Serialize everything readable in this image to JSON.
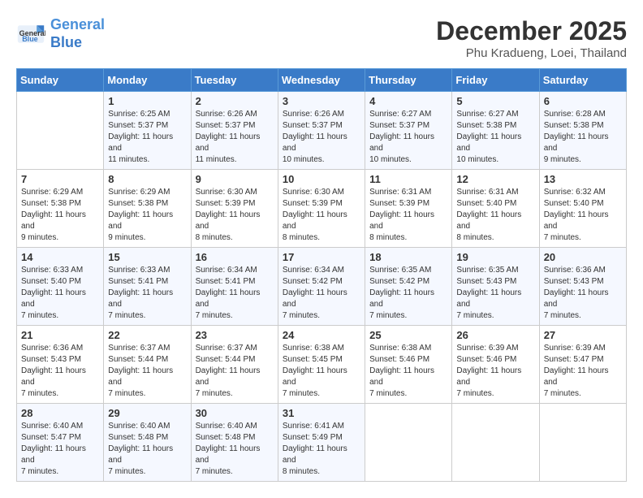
{
  "header": {
    "logo_line1": "General",
    "logo_line2": "Blue",
    "month": "December 2025",
    "location": "Phu Kradueng, Loei, Thailand"
  },
  "weekdays": [
    "Sunday",
    "Monday",
    "Tuesday",
    "Wednesday",
    "Thursday",
    "Friday",
    "Saturday"
  ],
  "weeks": [
    [
      {
        "day": "",
        "sunrise": "",
        "sunset": "",
        "daylight": ""
      },
      {
        "day": "1",
        "sunrise": "Sunrise: 6:25 AM",
        "sunset": "Sunset: 5:37 PM",
        "daylight": "Daylight: 11 hours and 11 minutes."
      },
      {
        "day": "2",
        "sunrise": "Sunrise: 6:26 AM",
        "sunset": "Sunset: 5:37 PM",
        "daylight": "Daylight: 11 hours and 11 minutes."
      },
      {
        "day": "3",
        "sunrise": "Sunrise: 6:26 AM",
        "sunset": "Sunset: 5:37 PM",
        "daylight": "Daylight: 11 hours and 10 minutes."
      },
      {
        "day": "4",
        "sunrise": "Sunrise: 6:27 AM",
        "sunset": "Sunset: 5:37 PM",
        "daylight": "Daylight: 11 hours and 10 minutes."
      },
      {
        "day": "5",
        "sunrise": "Sunrise: 6:27 AM",
        "sunset": "Sunset: 5:38 PM",
        "daylight": "Daylight: 11 hours and 10 minutes."
      },
      {
        "day": "6",
        "sunrise": "Sunrise: 6:28 AM",
        "sunset": "Sunset: 5:38 PM",
        "daylight": "Daylight: 11 hours and 9 minutes."
      }
    ],
    [
      {
        "day": "7",
        "sunrise": "Sunrise: 6:29 AM",
        "sunset": "Sunset: 5:38 PM",
        "daylight": "Daylight: 11 hours and 9 minutes."
      },
      {
        "day": "8",
        "sunrise": "Sunrise: 6:29 AM",
        "sunset": "Sunset: 5:38 PM",
        "daylight": "Daylight: 11 hours and 9 minutes."
      },
      {
        "day": "9",
        "sunrise": "Sunrise: 6:30 AM",
        "sunset": "Sunset: 5:39 PM",
        "daylight": "Daylight: 11 hours and 8 minutes."
      },
      {
        "day": "10",
        "sunrise": "Sunrise: 6:30 AM",
        "sunset": "Sunset: 5:39 PM",
        "daylight": "Daylight: 11 hours and 8 minutes."
      },
      {
        "day": "11",
        "sunrise": "Sunrise: 6:31 AM",
        "sunset": "Sunset: 5:39 PM",
        "daylight": "Daylight: 11 hours and 8 minutes."
      },
      {
        "day": "12",
        "sunrise": "Sunrise: 6:31 AM",
        "sunset": "Sunset: 5:40 PM",
        "daylight": "Daylight: 11 hours and 8 minutes."
      },
      {
        "day": "13",
        "sunrise": "Sunrise: 6:32 AM",
        "sunset": "Sunset: 5:40 PM",
        "daylight": "Daylight: 11 hours and 7 minutes."
      }
    ],
    [
      {
        "day": "14",
        "sunrise": "Sunrise: 6:33 AM",
        "sunset": "Sunset: 5:40 PM",
        "daylight": "Daylight: 11 hours and 7 minutes."
      },
      {
        "day": "15",
        "sunrise": "Sunrise: 6:33 AM",
        "sunset": "Sunset: 5:41 PM",
        "daylight": "Daylight: 11 hours and 7 minutes."
      },
      {
        "day": "16",
        "sunrise": "Sunrise: 6:34 AM",
        "sunset": "Sunset: 5:41 PM",
        "daylight": "Daylight: 11 hours and 7 minutes."
      },
      {
        "day": "17",
        "sunrise": "Sunrise: 6:34 AM",
        "sunset": "Sunset: 5:42 PM",
        "daylight": "Daylight: 11 hours and 7 minutes."
      },
      {
        "day": "18",
        "sunrise": "Sunrise: 6:35 AM",
        "sunset": "Sunset: 5:42 PM",
        "daylight": "Daylight: 11 hours and 7 minutes."
      },
      {
        "day": "19",
        "sunrise": "Sunrise: 6:35 AM",
        "sunset": "Sunset: 5:43 PM",
        "daylight": "Daylight: 11 hours and 7 minutes."
      },
      {
        "day": "20",
        "sunrise": "Sunrise: 6:36 AM",
        "sunset": "Sunset: 5:43 PM",
        "daylight": "Daylight: 11 hours and 7 minutes."
      }
    ],
    [
      {
        "day": "21",
        "sunrise": "Sunrise: 6:36 AM",
        "sunset": "Sunset: 5:43 PM",
        "daylight": "Daylight: 11 hours and 7 minutes."
      },
      {
        "day": "22",
        "sunrise": "Sunrise: 6:37 AM",
        "sunset": "Sunset: 5:44 PM",
        "daylight": "Daylight: 11 hours and 7 minutes."
      },
      {
        "day": "23",
        "sunrise": "Sunrise: 6:37 AM",
        "sunset": "Sunset: 5:44 PM",
        "daylight": "Daylight: 11 hours and 7 minutes."
      },
      {
        "day": "24",
        "sunrise": "Sunrise: 6:38 AM",
        "sunset": "Sunset: 5:45 PM",
        "daylight": "Daylight: 11 hours and 7 minutes."
      },
      {
        "day": "25",
        "sunrise": "Sunrise: 6:38 AM",
        "sunset": "Sunset: 5:46 PM",
        "daylight": "Daylight: 11 hours and 7 minutes."
      },
      {
        "day": "26",
        "sunrise": "Sunrise: 6:39 AM",
        "sunset": "Sunset: 5:46 PM",
        "daylight": "Daylight: 11 hours and 7 minutes."
      },
      {
        "day": "27",
        "sunrise": "Sunrise: 6:39 AM",
        "sunset": "Sunset: 5:47 PM",
        "daylight": "Daylight: 11 hours and 7 minutes."
      }
    ],
    [
      {
        "day": "28",
        "sunrise": "Sunrise: 6:40 AM",
        "sunset": "Sunset: 5:47 PM",
        "daylight": "Daylight: 11 hours and 7 minutes."
      },
      {
        "day": "29",
        "sunrise": "Sunrise: 6:40 AM",
        "sunset": "Sunset: 5:48 PM",
        "daylight": "Daylight: 11 hours and 7 minutes."
      },
      {
        "day": "30",
        "sunrise": "Sunrise: 6:40 AM",
        "sunset": "Sunset: 5:48 PM",
        "daylight": "Daylight: 11 hours and 7 minutes."
      },
      {
        "day": "31",
        "sunrise": "Sunrise: 6:41 AM",
        "sunset": "Sunset: 5:49 PM",
        "daylight": "Daylight: 11 hours and 8 minutes."
      },
      {
        "day": "",
        "sunrise": "",
        "sunset": "",
        "daylight": ""
      },
      {
        "day": "",
        "sunrise": "",
        "sunset": "",
        "daylight": ""
      },
      {
        "day": "",
        "sunrise": "",
        "sunset": "",
        "daylight": ""
      }
    ]
  ]
}
